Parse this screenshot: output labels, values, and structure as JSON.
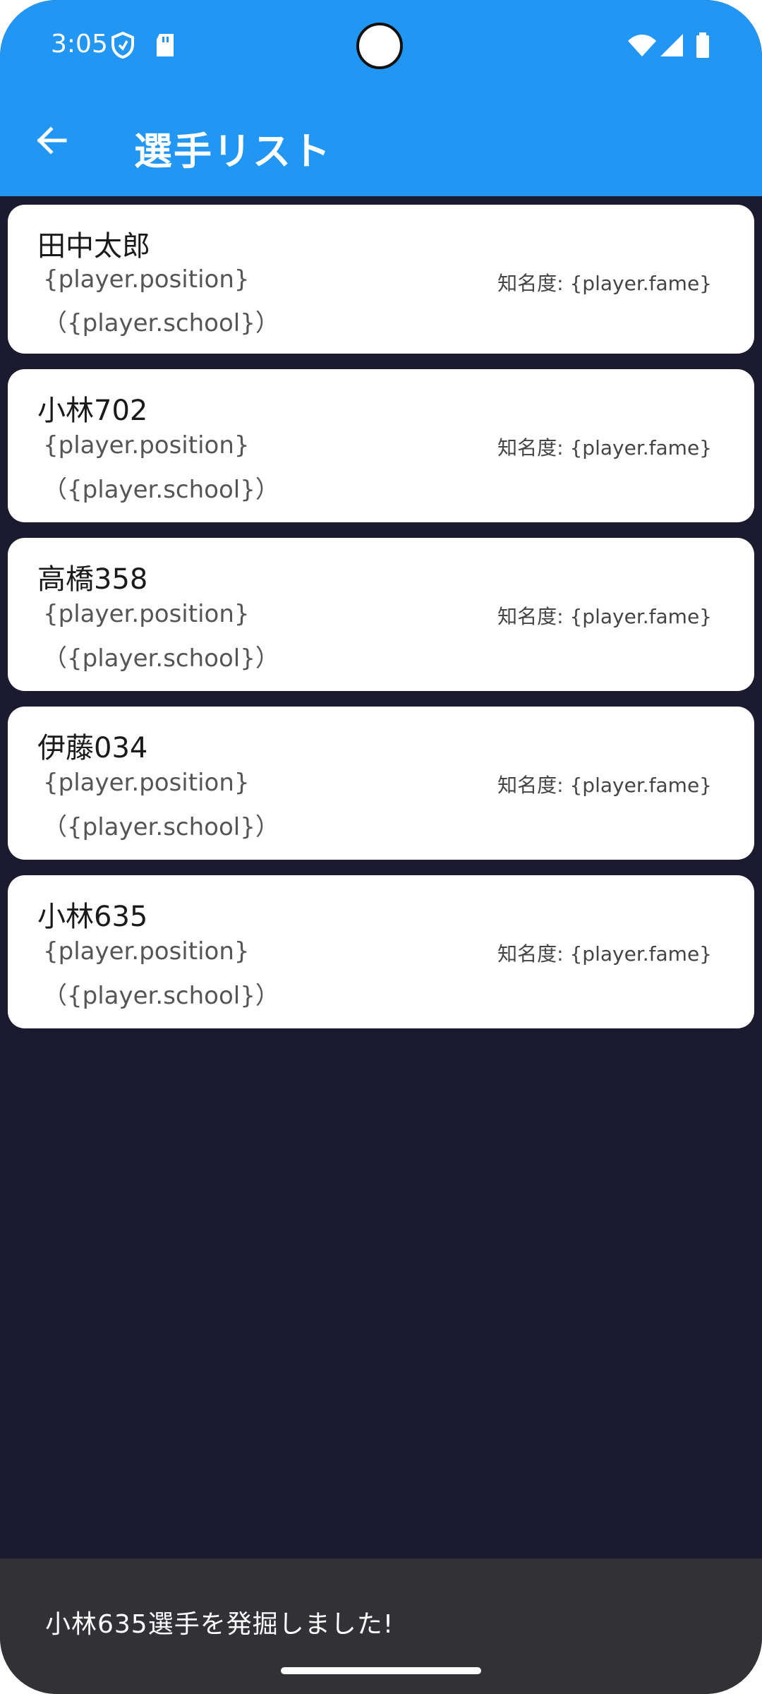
{
  "status_bar": {
    "time": "3:05",
    "icons": [
      "shield-icon",
      "sd-card-icon",
      "wifi-icon",
      "signal-icon",
      "battery-icon"
    ]
  },
  "app_bar": {
    "back_icon": "arrow-back-icon",
    "title": "選手リスト"
  },
  "players": [
    {
      "name": "田中太郎",
      "position": "{player.position}",
      "school": "（{player.school}）",
      "fame": "知名度: {player.fame}"
    },
    {
      "name": "小林702",
      "position": "{player.position}",
      "school": "（{player.school}）",
      "fame": "知名度: {player.fame}"
    },
    {
      "name": "高橋358",
      "position": "{player.position}",
      "school": "（{player.school}）",
      "fame": "知名度: {player.fame}"
    },
    {
      "name": "伊藤034",
      "position": "{player.position}",
      "school": "（{player.school}）",
      "fame": "知名度: {player.fame}"
    },
    {
      "name": "小林635",
      "position": "{player.position}",
      "school": "（{player.school}）",
      "fame": "知名度: {player.fame}"
    }
  ],
  "snackbar": {
    "message": "小林635選手を発掘しました!"
  },
  "colors": {
    "primary": "#2196f3",
    "background": "#1b1a2f",
    "card": "#ffffff",
    "snackbar": "#323136"
  }
}
